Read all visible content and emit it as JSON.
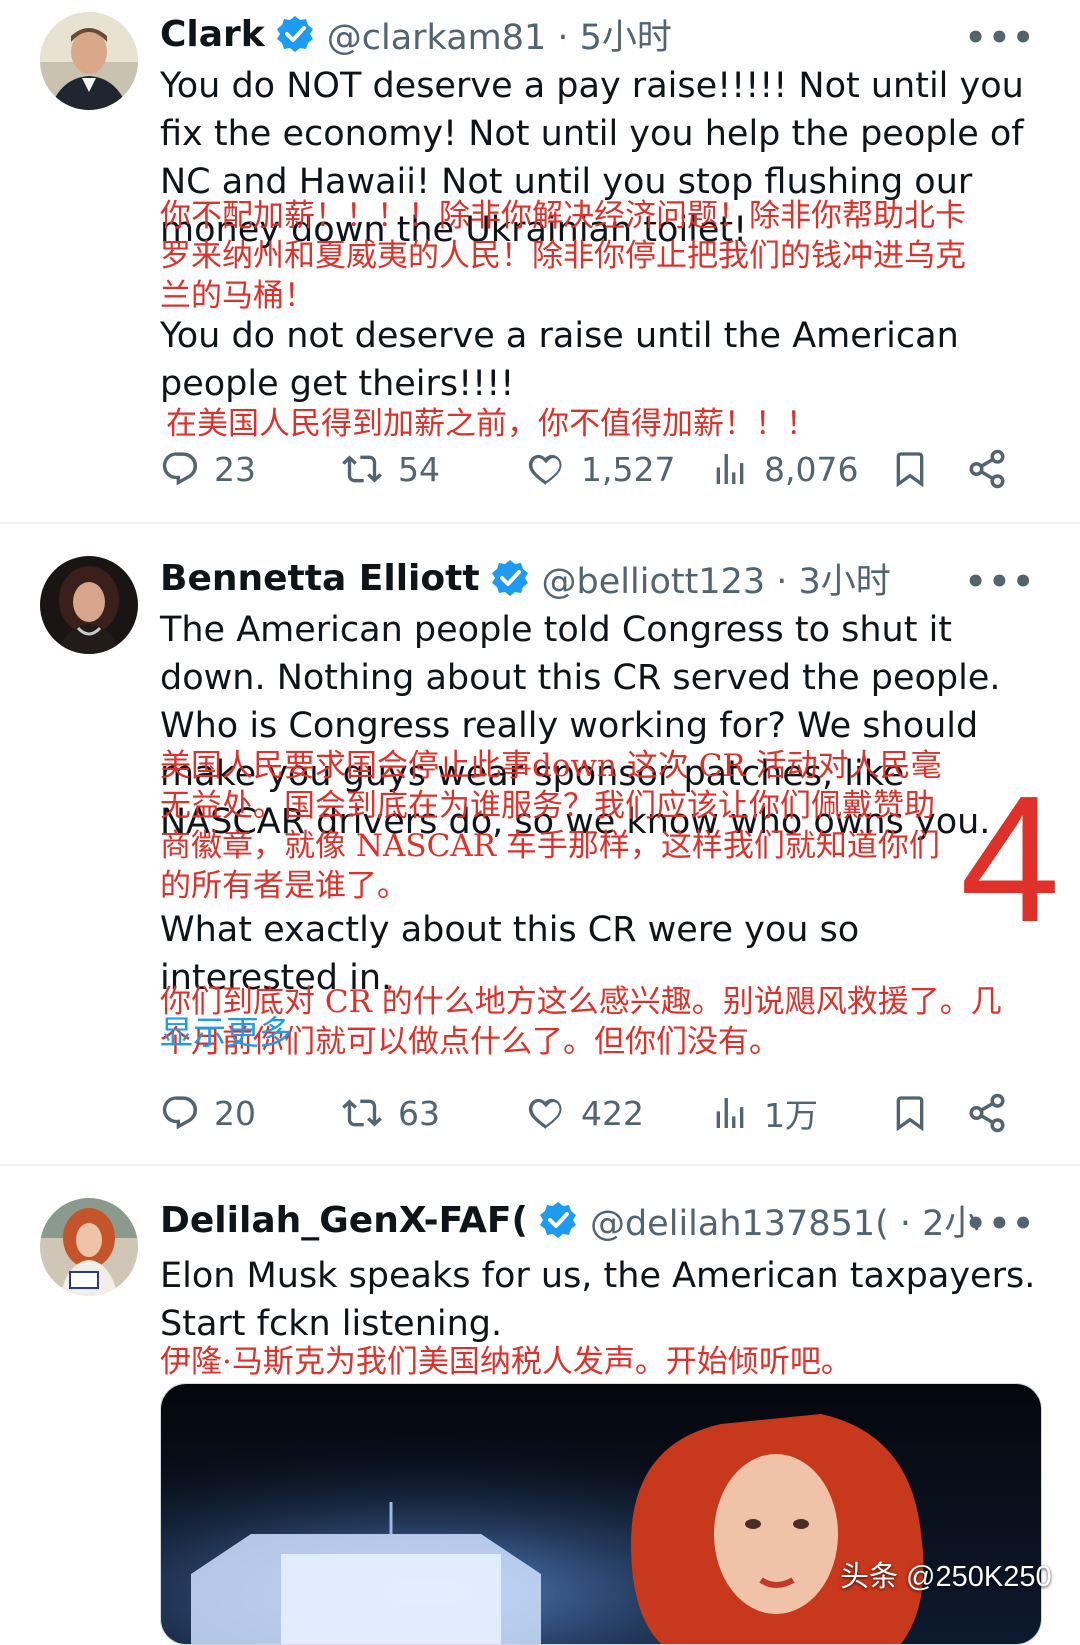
{
  "tweets": [
    {
      "name": "Clark",
      "handle": "@clarkam81 · 5小时",
      "text_1": "You do NOT deserve a pay raise!!!!! Not until you fix the economy! Not until you help the people of NC and Hawaii! Not until you stop flushing our money down the Ukrainian toilet!",
      "cn_1": "你不配加薪！！！！除非你解决经济问题！除非你帮助北卡罗来纳州和夏威夷的人民！除非你停止把我们的钱冲进乌克兰的马桶！",
      "text_2": "You do not deserve a raise until the American people get theirs!!!!",
      "cn_2": "在美国人民得到加薪之前，你不值得加薪！！！",
      "replies": "23",
      "reposts": "54",
      "likes": "1,527",
      "views": "8,076"
    },
    {
      "name": "Bennetta Elliott",
      "handle": "@belliott123 · 3小时",
      "text_1": "The American people told Congress to shut it down. Nothing about this CR served the people. Who is Congress really working for? We should make you guys wear sponsor patches, like NASCAR drivers do, so we know who owns you.",
      "cn_1": "美国人民要求国会停止此事down 这次 CR 活动对人民毫无益处。国会到底在为谁服务？我们应该让你们佩戴赞助商徽章，就像 NASCAR 车手那样，这样我们就知道你们的所有者是谁了。",
      "text_2": "What exactly about this CR were you so interested in.",
      "cn_2": "你们到底对 CR 的什么地方这么感兴趣。别说飓风救援了。几个月前你们就可以做点什么了。但你们没有。",
      "show_more": "显示更多",
      "replies": "20",
      "reposts": "63",
      "likes": "422",
      "views": "1万"
    },
    {
      "name": "Delilah_GenX-FAF(",
      "handle": "@delilah137851( · 2小时",
      "text_1": "Elon Musk speaks for us, the American taxpayers. Start fckn listening.",
      "cn_1": "伊隆·马斯克为我们美国纳税人发声。开始倾听吧。"
    }
  ],
  "annotation_number": "4",
  "watermark": "头条 @250K250",
  "colors": {
    "text": "#0f1419",
    "secondary": "#536471",
    "verified": "#1d9bf0",
    "translation_red": "#e0302a"
  },
  "icons": [
    "reply-icon",
    "repost-icon",
    "like-icon",
    "views-icon",
    "bookmark-icon",
    "share-icon",
    "more-icon",
    "verified-badge-icon"
  ]
}
